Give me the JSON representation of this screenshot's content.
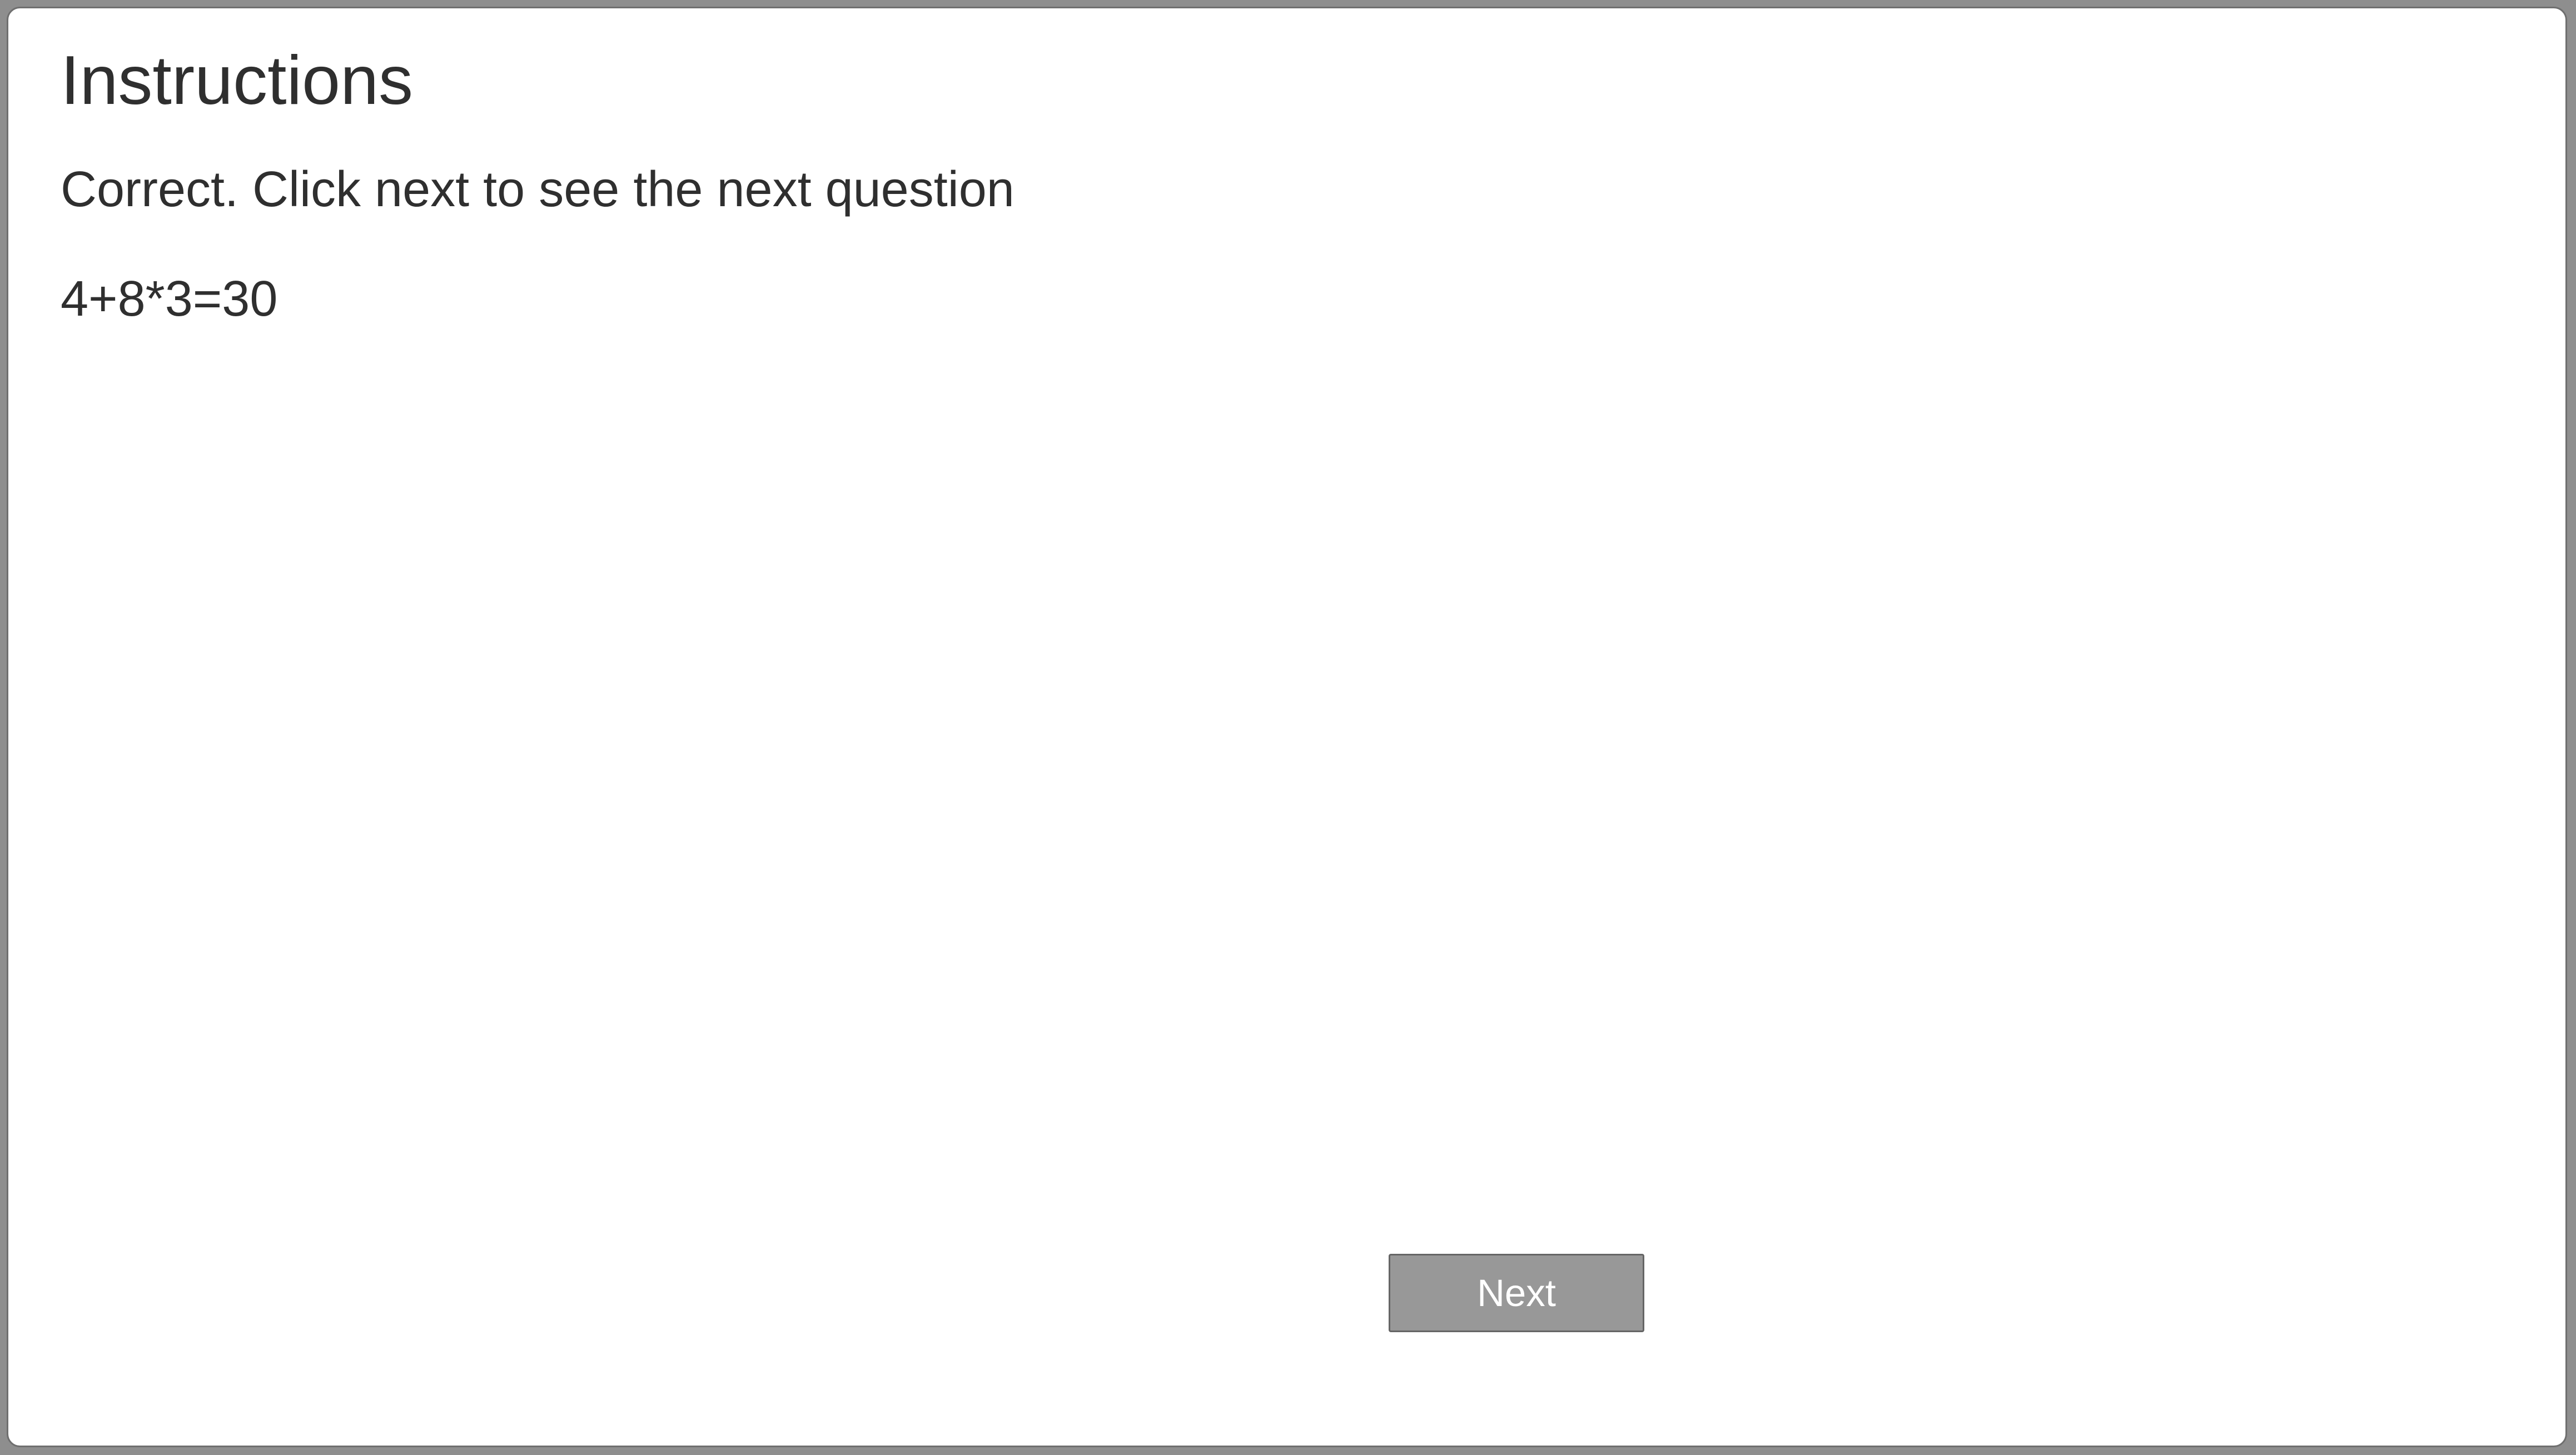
{
  "dialog": {
    "title": "Instructions",
    "feedback": "Correct. Click next to see the next question",
    "equation": "4+8*3=30",
    "next_label": "Next"
  },
  "colors": {
    "frame_background": "#8e8e8e",
    "panel_background": "#ffffff",
    "text": "#2f2f2f",
    "button_background": "#989898",
    "button_text": "#ffffff"
  }
}
